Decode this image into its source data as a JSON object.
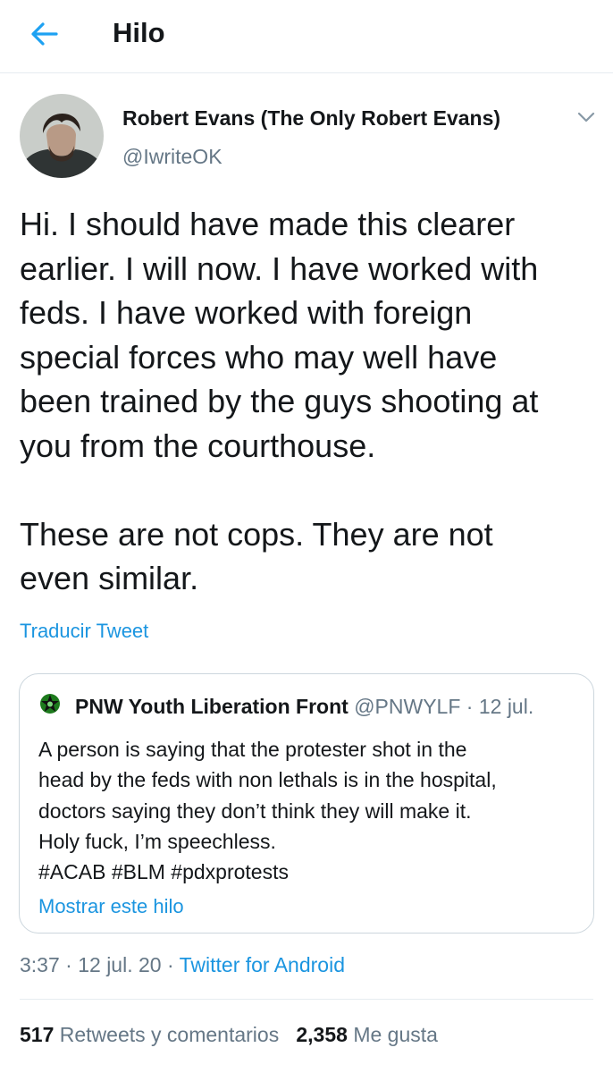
{
  "header": {
    "title": "Hilo",
    "back_icon": "arrow-left-icon"
  },
  "tweet": {
    "author_name": "Robert Evans (The Only Robert Evans)",
    "author_handle": "@IwriteOK",
    "text": "Hi. I should have made this clearer\nearlier. I will now. I have worked with\nfeds. I have worked with foreign\nspecial forces who may well have\nbeen trained by the guys shooting at\nyou from the courthouse.\n\nThese are not cops. They are not\neven similar.",
    "translate_label": "Traducir Tweet",
    "time": "3:37",
    "date": "12 jul. 20",
    "source": "Twitter for Android",
    "retweets_count": "517",
    "retweets_label": "Retweets y comentarios",
    "likes_count": "2,358",
    "likes_label": "Me gusta"
  },
  "quoted_tweet": {
    "author_name": "PNW Youth Liberation Front",
    "author_handle": "@PNWYLF",
    "date": "12 jul.",
    "text": "A person is saying that the protester shot in the\nhead by the feds with non lethals is in the hospital,\ndoctors saying they don’t think they will make it.\nHoly fuck, I’m speechless.\n#ACAB #BLM #pdxprotests",
    "show_thread_label": "Mostrar este hilo"
  },
  "separator": "·",
  "colors": {
    "accent": "#1b95e0",
    "text": "#14171a",
    "secondary": "#657786",
    "border": "#ccd6dd",
    "logo_green": "#2e8b2e"
  }
}
